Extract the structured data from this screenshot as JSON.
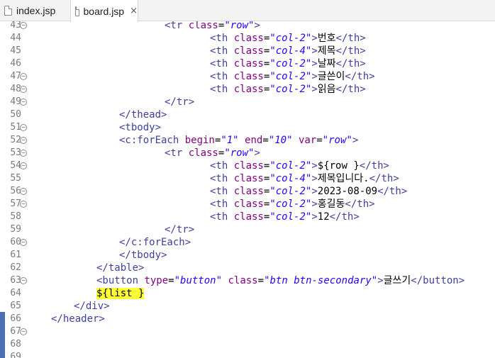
{
  "tabs": [
    {
      "label": "index.jsp",
      "active": false
    },
    {
      "label": "board.jsp",
      "active": true
    }
  ],
  "close_glyph": "×",
  "lines": [
    {
      "n": "43",
      "fold": true,
      "indent": 6,
      "tokens": [
        [
          "t",
          "<tr "
        ],
        [
          "a",
          "class"
        ],
        [
          "x",
          "="
        ],
        [
          "v",
          "\"row\""
        ],
        [
          "t",
          ">"
        ]
      ]
    },
    {
      "n": "44",
      "fold": false,
      "indent": 8,
      "tokens": [
        [
          "t",
          "<th "
        ],
        [
          "a",
          "class"
        ],
        [
          "x",
          "="
        ],
        [
          "v",
          "\"col-2\""
        ],
        [
          "t",
          ">"
        ],
        [
          "x",
          "번호"
        ],
        [
          "t",
          "</th>"
        ]
      ]
    },
    {
      "n": "45",
      "fold": false,
      "indent": 8,
      "tokens": [
        [
          "t",
          "<th "
        ],
        [
          "a",
          "class"
        ],
        [
          "x",
          "="
        ],
        [
          "v",
          "\"col-4\""
        ],
        [
          "t",
          ">"
        ],
        [
          "x",
          "제목"
        ],
        [
          "t",
          "</th>"
        ]
      ]
    },
    {
      "n": "46",
      "fold": false,
      "indent": 8,
      "tokens": [
        [
          "t",
          "<th "
        ],
        [
          "a",
          "class"
        ],
        [
          "x",
          "="
        ],
        [
          "v",
          "\"col-2\""
        ],
        [
          "t",
          ">"
        ],
        [
          "x",
          "날짜"
        ],
        [
          "t",
          "</th>"
        ]
      ]
    },
    {
      "n": "47",
      "fold": true,
      "indent": 8,
      "tokens": [
        [
          "t",
          "<th "
        ],
        [
          "a",
          "class"
        ],
        [
          "x",
          "="
        ],
        [
          "v",
          "\"col-2\""
        ],
        [
          "t",
          ">"
        ],
        [
          "x",
          "글쓴이"
        ],
        [
          "t",
          "</th>"
        ]
      ]
    },
    {
      "n": "48",
      "fold": true,
      "indent": 8,
      "tokens": [
        [
          "t",
          "<th "
        ],
        [
          "a",
          "class"
        ],
        [
          "x",
          "="
        ],
        [
          "v",
          "\"col-2\""
        ],
        [
          "t",
          ">"
        ],
        [
          "x",
          "읽음"
        ],
        [
          "t",
          "</th>"
        ]
      ]
    },
    {
      "n": "49",
      "fold": true,
      "indent": 6,
      "tokens": [
        [
          "t",
          "</tr>"
        ]
      ]
    },
    {
      "n": "50",
      "fold": false,
      "indent": 4,
      "tokens": [
        [
          "t",
          "</thead>"
        ]
      ]
    },
    {
      "n": "51",
      "fold": true,
      "indent": 4,
      "tokens": [
        [
          "t",
          "<tbody>"
        ]
      ]
    },
    {
      "n": "52",
      "fold": true,
      "indent": 4,
      "tokens": [
        [
          "t",
          "<c:forEach "
        ],
        [
          "a",
          "begin"
        ],
        [
          "x",
          "="
        ],
        [
          "v",
          "\"1\""
        ],
        [
          "x",
          " "
        ],
        [
          "a",
          "end"
        ],
        [
          "x",
          "="
        ],
        [
          "v",
          "\"10\""
        ],
        [
          "x",
          " "
        ],
        [
          "a",
          "var"
        ],
        [
          "x",
          "="
        ],
        [
          "v",
          "\"row\""
        ],
        [
          "t",
          ">"
        ]
      ]
    },
    {
      "n": "53",
      "fold": true,
      "indent": 6,
      "tokens": [
        [
          "t",
          "<tr "
        ],
        [
          "a",
          "class"
        ],
        [
          "x",
          "="
        ],
        [
          "v",
          "\"row\""
        ],
        [
          "t",
          ">"
        ]
      ]
    },
    {
      "n": "54",
      "fold": true,
      "indent": 8,
      "tokens": [
        [
          "t",
          "<th "
        ],
        [
          "a",
          "class"
        ],
        [
          "x",
          "="
        ],
        [
          "v",
          "\"col-2\""
        ],
        [
          "t",
          ">"
        ],
        [
          "x",
          "${row }"
        ],
        [
          "t",
          "</th>"
        ]
      ]
    },
    {
      "n": "55",
      "fold": false,
      "indent": 8,
      "tokens": [
        [
          "t",
          "<th "
        ],
        [
          "a",
          "class"
        ],
        [
          "x",
          "="
        ],
        [
          "v",
          "\"col-4\""
        ],
        [
          "t",
          ">"
        ],
        [
          "x",
          "제목입니다."
        ],
        [
          "t",
          "</th>"
        ]
      ]
    },
    {
      "n": "56",
      "fold": true,
      "indent": 8,
      "tokens": [
        [
          "t",
          "<th "
        ],
        [
          "a",
          "class"
        ],
        [
          "x",
          "="
        ],
        [
          "v",
          "\"col-2\""
        ],
        [
          "t",
          ">"
        ],
        [
          "x",
          "2023-08-09"
        ],
        [
          "t",
          "</th>"
        ]
      ]
    },
    {
      "n": "57",
      "fold": true,
      "indent": 8,
      "tokens": [
        [
          "t",
          "<th "
        ],
        [
          "a",
          "class"
        ],
        [
          "x",
          "="
        ],
        [
          "v",
          "\"col-2\""
        ],
        [
          "t",
          ">"
        ],
        [
          "x",
          "홍길동"
        ],
        [
          "t",
          "</th>"
        ]
      ]
    },
    {
      "n": "58",
      "fold": false,
      "indent": 8,
      "tokens": [
        [
          "t",
          "<th "
        ],
        [
          "a",
          "class"
        ],
        [
          "x",
          "="
        ],
        [
          "v",
          "\"col-2\""
        ],
        [
          "t",
          ">"
        ],
        [
          "x",
          "12"
        ],
        [
          "t",
          "</th>"
        ]
      ]
    },
    {
      "n": "59",
      "fold": false,
      "indent": 6,
      "tokens": [
        [
          "t",
          "</tr>"
        ]
      ]
    },
    {
      "n": "60",
      "fold": true,
      "indent": 4,
      "tokens": [
        [
          "t",
          "</c:forEach>"
        ]
      ]
    },
    {
      "n": "61",
      "fold": false,
      "indent": 4,
      "tokens": [
        [
          "t",
          "</tbody>"
        ]
      ]
    },
    {
      "n": "62",
      "fold": false,
      "indent": 3,
      "tokens": [
        [
          "t",
          "</table>"
        ]
      ]
    },
    {
      "n": "63",
      "fold": true,
      "indent": 3,
      "tokens": [
        [
          "t",
          "<button "
        ],
        [
          "a",
          "type"
        ],
        [
          "x",
          "="
        ],
        [
          "v",
          "\"button\""
        ],
        [
          "x",
          " "
        ],
        [
          "a",
          "class"
        ],
        [
          "x",
          "="
        ],
        [
          "v",
          "\"btn btn-secondary\""
        ],
        [
          "t",
          ">"
        ],
        [
          "x",
          "글쓰기"
        ],
        [
          "t",
          "</button>"
        ]
      ]
    },
    {
      "n": "64",
      "fold": false,
      "indent": 3,
      "tokens": [
        [
          "hl",
          "${list }"
        ]
      ]
    },
    {
      "n": "65",
      "fold": false,
      "indent": 2,
      "tokens": [
        [
          "t",
          "</div>"
        ]
      ]
    },
    {
      "n": "66",
      "fold": false,
      "indent": 1,
      "tokens": [
        [
          "t",
          "</header>"
        ]
      ]
    },
    {
      "n": "67",
      "fold": true,
      "indent": 0,
      "tokens": []
    },
    {
      "n": "68",
      "fold": false,
      "indent": 0,
      "tokens": []
    },
    {
      "n": "69",
      "fold": false,
      "indent": 0,
      "tokens": []
    }
  ],
  "colors": {
    "tag": "#3f3fa0",
    "attribute": "#7f007f",
    "value": "#2a00ff",
    "highlight": "#ffff33",
    "ruler_mark": "#4b6fb0"
  },
  "icons": {
    "file": "file-icon",
    "close": "close-icon",
    "fold": "fold-minus-icon"
  }
}
